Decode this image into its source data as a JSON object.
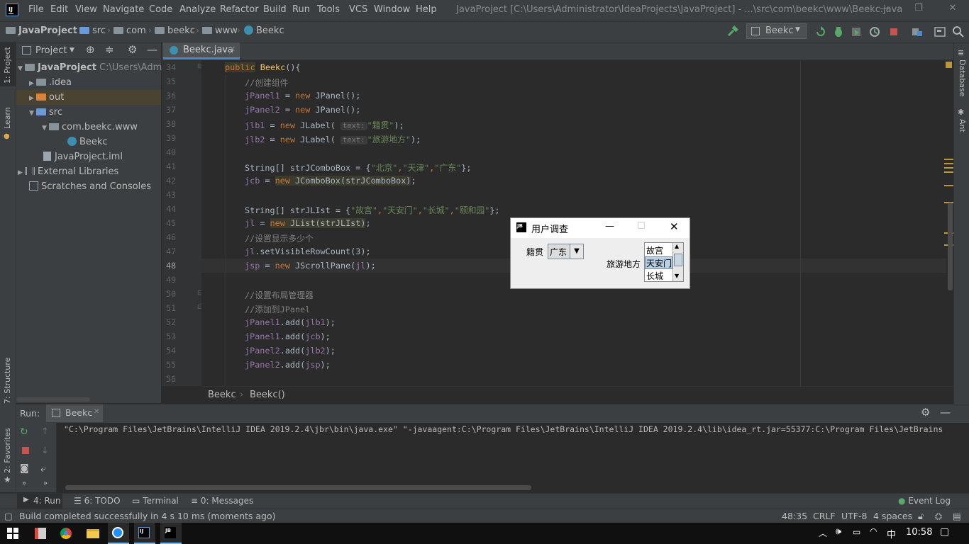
{
  "menu": {
    "items": [
      "File",
      "Edit",
      "View",
      "Navigate",
      "Code",
      "Analyze",
      "Refactor",
      "Build",
      "Run",
      "Tools",
      "VCS",
      "Window",
      "Help"
    ],
    "window_title": "JavaProject [C:\\Users\\Administrator\\IdeaProjects\\JavaProject] - ...\\src\\com\\beekc\\www\\Beekc.java"
  },
  "navbar": {
    "crumbs": [
      "JavaProject",
      "src",
      "com",
      "beekc",
      "www",
      "Beekc"
    ],
    "run_config": "Beekc"
  },
  "left_strip": {
    "project": "1: Project",
    "learn": "Learn",
    "structure": "7: Structure",
    "favorites": "2: Favorites"
  },
  "right_strip": {
    "database": "Database",
    "ant": "Ant"
  },
  "project_panel": {
    "title": "Project",
    "tree": [
      {
        "label": "JavaProject",
        "extra": "C:\\Users\\Admin"
      },
      {
        "label": ".idea"
      },
      {
        "label": "out"
      },
      {
        "label": "src"
      },
      {
        "label": "com.beekc.www"
      },
      {
        "label": "Beekc"
      },
      {
        "label": "JavaProject.iml"
      },
      {
        "label": "External Libraries"
      },
      {
        "label": "Scratches and Consoles"
      }
    ]
  },
  "editor": {
    "tab": "Beekc.java",
    "line_numbers": [
      "34",
      "35",
      "36",
      "37",
      "38",
      "39",
      "40",
      "41",
      "42",
      "43",
      "44",
      "45",
      "46",
      "47",
      "48",
      "49",
      "50",
      "51",
      "52",
      "53",
      "54",
      "55",
      "56"
    ],
    "code": {
      "l34": {
        "kw": "public",
        "name": "Beekc",
        "rest": "(){"
      },
      "l35": "//创建组件",
      "l36": {
        "field": "jPanel1",
        "mid": " = ",
        "kw": "new",
        "rest": " JPanel();"
      },
      "l37": {
        "field": "jPanel2",
        "mid": " = ",
        "kw": "new",
        "rest": " JPanel();"
      },
      "l38": {
        "field": "jlb1",
        "mid": " = ",
        "kw": "new",
        "call": " JLabel(",
        "hint": "text:",
        "str": "\"籍贯\"",
        "end": ");"
      },
      "l39": {
        "field": "jlb2",
        "mid": " = ",
        "kw": "new",
        "call": " JLabel(",
        "hint": "text:",
        "str": "\"旅游地方\"",
        "end": ");"
      },
      "l41": {
        "pre": "String[] strJComboBox = {",
        "s1": "\"北京\"",
        "s2": "\"天津\"",
        "s3": "\"广东\"",
        "end": "};"
      },
      "l42": {
        "field": "jcb",
        "mid": " = ",
        "kw": "new",
        "rest": " JComboBox(strJComboBox)",
        "end": ";"
      },
      "l44": {
        "pre": "String[] strJLIst = {",
        "s1": "\"故宫\"",
        "s2": "\"天安门\"",
        "s3": "\"长城\"",
        "s4": "\"颐和园\"",
        "end": "};"
      },
      "l45": {
        "field": "jl",
        "mid": " = ",
        "kw": "new",
        "rest": " JList(strJLIst)",
        "end": ";"
      },
      "l46": "//设置显示多少个",
      "l47": {
        "field": "jl",
        "rest": ".setVisibleRowCount(3);"
      },
      "l48": {
        "field": "jsp",
        "mid": " = ",
        "kw": "new",
        "call": " JScrollPane(",
        "arg": "jl",
        "end": ");"
      },
      "l50": "//设置布局管理器",
      "l51": "//添加到JPanel",
      "l52": {
        "field": "jPanel1",
        "rest": ".add(",
        "arg": "jlb1",
        "end": ");"
      },
      "l53": {
        "field": "jPanel1",
        "rest": ".add(",
        "arg": "jcb",
        "end": ");"
      },
      "l54": {
        "field": "jPanel2",
        "rest": ".add(",
        "arg": "jlb2",
        "end": ");"
      },
      "l55": {
        "field": "jPanel2",
        "rest": ".add(",
        "arg": "jsp",
        "end": ");"
      }
    },
    "breadcrumb": [
      "Beekc",
      "Beekc()"
    ]
  },
  "dialog": {
    "title": "用户调查",
    "label1": "籍贯",
    "combo_value": "广东",
    "label2": "旅游地方",
    "list_items": [
      "故宫",
      "天安门",
      "长城"
    ],
    "selected_index": 1
  },
  "run": {
    "label": "Run:",
    "tab": "Beekc",
    "command": "\"C:\\Program Files\\JetBrains\\IntelliJ IDEA 2019.2.4\\jbr\\bin\\java.exe\" \"-javaagent:C:\\Program Files\\JetBrains\\IntelliJ IDEA 2019.2.4\\lib\\idea_rt.jar=55377:C:\\Program Files\\JetBrains"
  },
  "tool_windows": {
    "run": "4: Run",
    "todo": "6: TODO",
    "terminal": "Terminal",
    "messages": "0: Messages",
    "event_log": "Event Log"
  },
  "status": {
    "message": "Build completed successfully in 4 s 10 ms (moments ago)",
    "position": "48:35",
    "line_sep": "CRLF",
    "encoding": "UTF-8",
    "indent": "4 spaces"
  },
  "taskbar": {
    "ime": "中",
    "time": "10:58"
  },
  "colors": {
    "accent": "#4a88c7",
    "keyword": "#cc7832",
    "field": "#9876aa",
    "string": "#6a8759",
    "comment": "#808080"
  }
}
